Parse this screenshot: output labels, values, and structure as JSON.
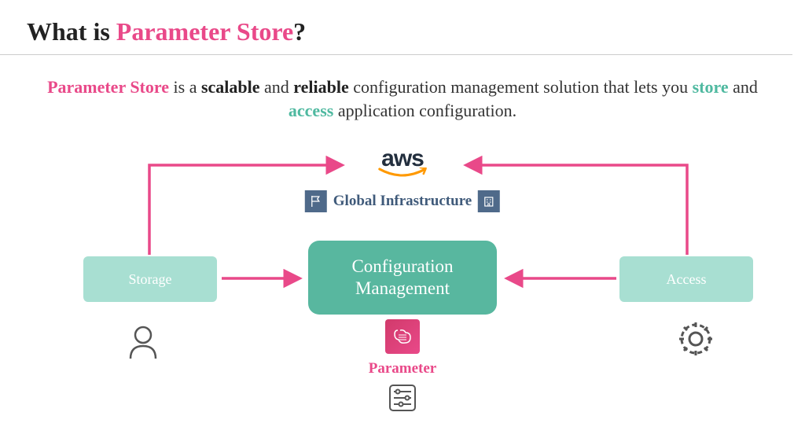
{
  "title": {
    "prefix": "What is ",
    "highlight": "Parameter Store",
    "suffix": "?"
  },
  "subtitle": {
    "parts": [
      {
        "text": "Parameter Store",
        "class": "pink"
      },
      {
        "text": " is a ",
        "class": ""
      },
      {
        "text": "scalable",
        "class": "bold"
      },
      {
        "text": " and ",
        "class": ""
      },
      {
        "text": "reliable",
        "class": "bold"
      },
      {
        "text": " configuration management solution that lets you ",
        "class": ""
      },
      {
        "text": "store",
        "class": "teal"
      },
      {
        "text": " and ",
        "class": ""
      },
      {
        "text": "access",
        "class": "teal"
      },
      {
        "text": " application configuration.",
        "class": ""
      }
    ]
  },
  "aws": {
    "logo_text": "aws",
    "global_label": "Global Infrastructure"
  },
  "boxes": {
    "storage": "Storage",
    "config": "Configuration Management",
    "access": "Access"
  },
  "param_label": "Parameter"
}
